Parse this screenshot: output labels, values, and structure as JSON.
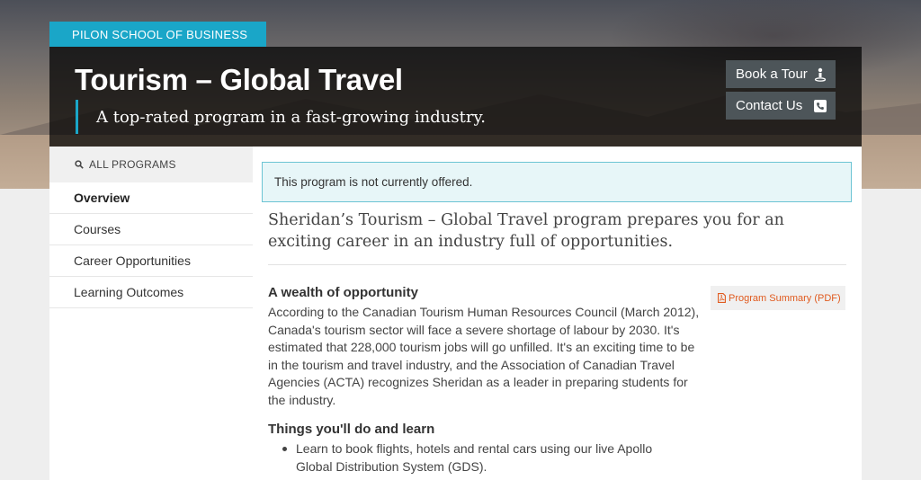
{
  "school": "PILON SCHOOL OF BUSINESS",
  "hero": {
    "title": "Tourism – Global Travel",
    "subtitle": "A top-rated program in a fast-growing industry."
  },
  "cta": {
    "tour": "Book a Tour",
    "contact": "Contact Us"
  },
  "sidebar": {
    "all_programs": "ALL PROGRAMS",
    "items": [
      {
        "label": "Overview"
      },
      {
        "label": "Courses"
      },
      {
        "label": "Career Opportunities"
      },
      {
        "label": "Learning Outcomes"
      }
    ]
  },
  "main": {
    "notice": "This program is not currently offered.",
    "lead": "Sheridan’s Tourism – Global Travel program prepares you for an exciting career in an industry full of opportunities.",
    "section1": {
      "heading": "A wealth of opportunity",
      "body": "According to the Canadian Tourism Human Resources Council (March 2012), Canada's tourism sector will face a severe shortage of labour by 2030. It's estimated that 228,000 tourism jobs will go unfilled. It's an exciting time to be in the tourism and travel industry, and the Association of Canadian Travel Agencies (ACTA) recognizes Sheridan as a leader in preparing students for the industry."
    },
    "pdf_label": "Program Summary (PDF)",
    "section2": {
      "heading": "Things you'll do and learn",
      "bullets": [
        "Learn to book flights, hotels and rental cars using our live Apollo Global Distribution System (GDS)."
      ]
    }
  },
  "colors": {
    "accent": "#1aa6c8",
    "pdf": "#e05a1e"
  },
  "icons": {
    "tour": "map-pin-person-icon",
    "contact": "phone-icon",
    "search": "search-icon",
    "pdf": "pdf-file-icon"
  }
}
